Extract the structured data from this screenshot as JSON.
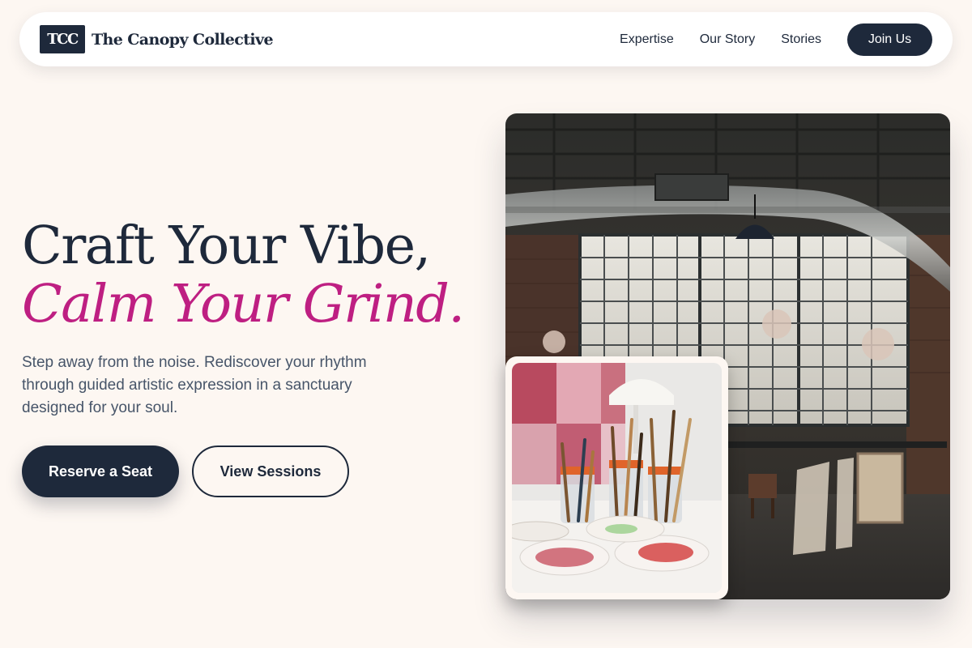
{
  "brand": {
    "logo_text": "TCC",
    "name": "The Canopy Collective"
  },
  "nav": {
    "links": [
      "Expertise",
      "Our Story",
      "Stories"
    ],
    "cta": "Join Us"
  },
  "hero": {
    "headline_line1": "Craft Your Vibe,",
    "headline_line2": "Calm Your Grind.",
    "subtext": "Step away from the noise. Rediscover your rhythm through guided artistic expression in a sanctuary designed for your soul.",
    "primary_button": "Reserve a Seat",
    "secondary_button": "View Sessions"
  },
  "images": {
    "main": "industrial-loft-studio-photo",
    "inset": "paint-brushes-in-jars-photo"
  },
  "colors": {
    "navy": "#1e293b",
    "accent": "#be1f82",
    "background": "#fdf7f2",
    "body_text": "#475569"
  }
}
